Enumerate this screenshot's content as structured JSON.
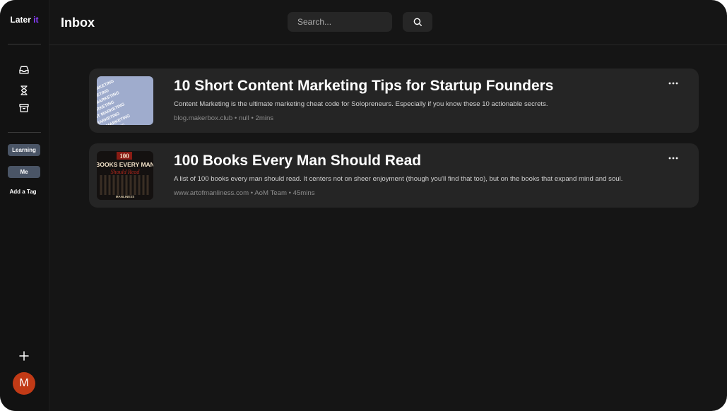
{
  "app": {
    "brand_prefix": "Later",
    "brand_accent": "it",
    "accent_color": "#8b3dff"
  },
  "sidebar": {
    "nav_icons": [
      "inbox-icon",
      "hourglass-icon",
      "archive-icon"
    ],
    "tags": [
      {
        "label": "Learning"
      },
      {
        "label": "Me"
      }
    ],
    "add_tag_label": "Add a Tag",
    "add_icon": "plus-icon",
    "avatar_initial": "M",
    "avatar_color": "#c13a16"
  },
  "header": {
    "title": "Inbox",
    "search_placeholder": "Search...",
    "search_icon": "search-icon"
  },
  "articles": [
    {
      "title": "10 Short Content Marketing Tips for Startup Founders",
      "description": "Content Marketing is the ultimate marketing cheat code for Solopreneurs. Especially if you know these 10 actionable secrets.",
      "meta": "blog.makerbox.club • null • 2mins",
      "thumbnail_text": "CONTENT MARKETING"
    },
    {
      "title": "100 Books Every Man Should Read",
      "description": "A list of 100 books every man should read. It centers not on sheer enjoyment (though you'll find that too), but on the books that expand mind and soul.",
      "meta": "www.artofmanliness.com • AoM Team • 45mins",
      "thumbnail_number": "100",
      "thumbnail_line1": "BOOKS EVERY MAN",
      "thumbnail_line2": "Should Read",
      "thumbnail_footer": "MANLINESS"
    }
  ]
}
